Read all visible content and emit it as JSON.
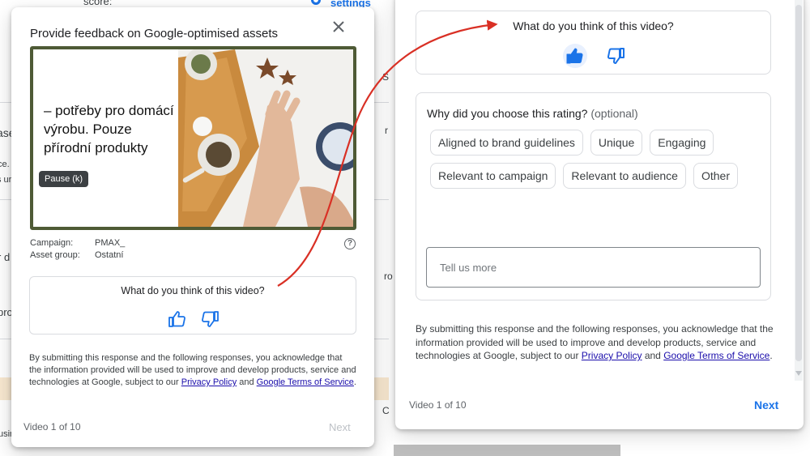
{
  "background": {
    "top_label": "score:",
    "settings_link": "settings",
    "fragments": [
      "ase.",
      "ce.",
      "s ur",
      "r d",
      "pro",
      "S",
      "r",
      "ro",
      "C",
      "usin"
    ]
  },
  "left_dialog": {
    "title": "Provide feedback on Google-optimised assets",
    "video_text": "– potřeby pro domácí výrobu. Pouze přírodní produkty",
    "pause_tooltip": "Pause (k)",
    "campaign_label": "Campaign:",
    "campaign_value": "PMAX_",
    "asset_group_label": "Asset group:",
    "asset_group_value": "Ostatní",
    "help_icon": "?",
    "question": "What do you think of this video?",
    "disclaimer_pre": "By submitting this response and the following responses, you acknowledge that the information provided will be used to improve and develop products, service and technologies at Google, subject to our ",
    "privacy_link": "Privacy Policy",
    "and": " and ",
    "terms_link": "Google Terms of Service",
    "period": ".",
    "counter": "Video 1 of 10",
    "next": "Next"
  },
  "right_dialog": {
    "question": "What do you think of this video?",
    "rating_selected": "thumbs-up",
    "why_question": "Why did you choose this rating?",
    "why_optional": "(optional)",
    "chips": [
      "Aligned to brand guidelines",
      "Unique",
      "Engaging",
      "Relevant to campaign",
      "Relevant to audience",
      "Other"
    ],
    "tell_more_placeholder": "Tell us more",
    "disclaimer_pre": "By submitting this response and the following responses, you acknowledge that the information provided will be used to improve and develop products, service and technologies at Google, subject to our ",
    "privacy_link": "Privacy Policy",
    "and": " and ",
    "terms_link": "Google Terms of Service",
    "period": ".",
    "counter": "Video 1 of 10",
    "next": "Next"
  },
  "colors": {
    "accent": "#1a73e8",
    "annotation_arrow": "#d93025",
    "video_border": "#4e5a35"
  }
}
